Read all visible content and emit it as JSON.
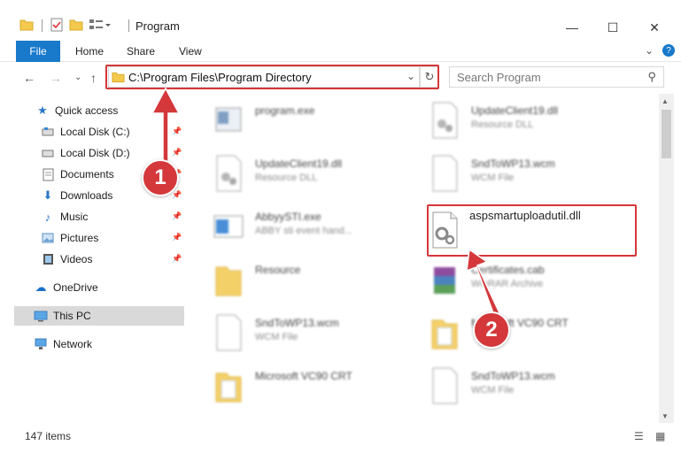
{
  "window": {
    "title": "Program",
    "min": "—",
    "max": "☐",
    "close": "✕"
  },
  "ribbon": {
    "file": "File",
    "home": "Home",
    "share": "Share",
    "view": "View"
  },
  "address": {
    "path": "C:\\Program Files\\Program Directory",
    "search_placeholder": "Search Program"
  },
  "nav": [
    {
      "label": "Quick access"
    },
    {
      "label": "Local Disk (C:)"
    },
    {
      "label": "Local Disk (D:)"
    },
    {
      "label": "Documents"
    },
    {
      "label": "Downloads"
    },
    {
      "label": "Music"
    },
    {
      "label": "Pictures"
    },
    {
      "label": "Videos"
    },
    {
      "label": "OneDrive"
    },
    {
      "label": "This PC"
    },
    {
      "label": "Network"
    }
  ],
  "files": [
    {
      "name": "program.exe",
      "sub": ""
    },
    {
      "name": "UpdateClient19.dll",
      "sub": "Resource DLL"
    },
    {
      "name": "UpdateClient19.dll",
      "sub": "Resource DLL"
    },
    {
      "name": "SndToWP13.wcm",
      "sub": "WCM File"
    },
    {
      "name": "AbbyySTI.exe",
      "sub": "ABBY sti event hand..."
    },
    {
      "name": "aspsmartuploadutil.dll",
      "sub": ""
    },
    {
      "name": "Resource",
      "sub": ""
    },
    {
      "name": "Certificates.cab",
      "sub": "WinRAR Archive"
    },
    {
      "name": "SndToWP13.wcm",
      "sub": "WCM File"
    },
    {
      "name": "Microsoft VC90 CRT",
      "sub": ""
    },
    {
      "name": "Microsoft VC90 CRT",
      "sub": ""
    },
    {
      "name": "SndToWP13.wcm",
      "sub": "WCM File"
    }
  ],
  "status": {
    "count": "147 items"
  },
  "annotations": {
    "step1": "1",
    "step2": "2",
    "color": "#d4383b"
  }
}
